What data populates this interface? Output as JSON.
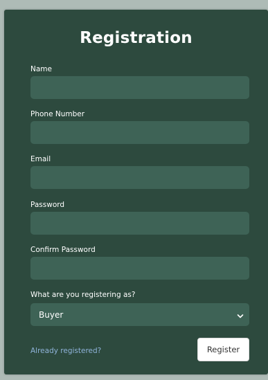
{
  "form": {
    "title": "Registration",
    "fields": [
      {
        "label": "Name",
        "value": ""
      },
      {
        "label": "Phone Number",
        "value": ""
      },
      {
        "label": "Email",
        "value": ""
      },
      {
        "label": "Password",
        "value": ""
      },
      {
        "label": "Confirm Password",
        "value": ""
      }
    ],
    "role": {
      "label": "What are you registering as?",
      "selected": "Buyer"
    },
    "login_link": "Already registered?",
    "submit_label": "Register"
  },
  "colors": {
    "background": "#aebbb6",
    "card": "#2d4a3e",
    "input": "#3e6356",
    "link": "#8fb3d9"
  },
  "icons": {
    "select_arrow": "chevron-down-icon"
  }
}
